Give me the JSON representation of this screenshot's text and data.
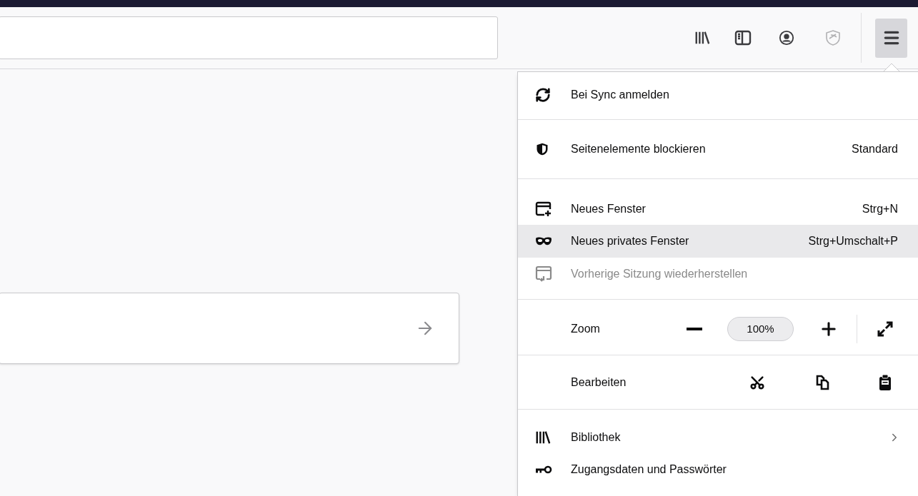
{
  "toolbar": {
    "menu_button": {
      "pressed": true
    }
  },
  "menu": {
    "sections": [
      {
        "items": [
          {
            "kind": "item",
            "label": "Bei Sync anmelden",
            "highlighted": false,
            "disabled": false,
            "submenu": false
          }
        ]
      },
      {
        "items": [
          {
            "kind": "item",
            "label": "Seitenelemente blockieren",
            "shortcut": "Standard",
            "highlighted": false,
            "disabled": false,
            "submenu": false
          }
        ]
      },
      {
        "items": [
          {
            "kind": "item",
            "label": "Neues Fenster",
            "shortcut": "Strg+N",
            "highlighted": false,
            "disabled": false,
            "submenu": false
          },
          {
            "kind": "item",
            "label": "Neues privates Fenster",
            "shortcut": "Strg+Umschalt+P",
            "highlighted": true,
            "disabled": false,
            "submenu": false
          },
          {
            "kind": "item",
            "label": "Vorherige Sitzung wiederherstellen",
            "highlighted": false,
            "disabled": true,
            "submenu": false
          }
        ]
      },
      {
        "items": [
          {
            "kind": "zoom",
            "label": "Zoom",
            "value": "100%"
          }
        ]
      },
      {
        "items": [
          {
            "kind": "edit",
            "label": "Bearbeiten"
          }
        ]
      },
      {
        "items": [
          {
            "kind": "item",
            "label": "Bibliothek",
            "highlighted": false,
            "disabled": false,
            "submenu": true
          },
          {
            "kind": "item",
            "label": "Zugangsdaten und Passwörter",
            "highlighted": false,
            "disabled": false,
            "submenu": false
          }
        ]
      }
    ]
  }
}
